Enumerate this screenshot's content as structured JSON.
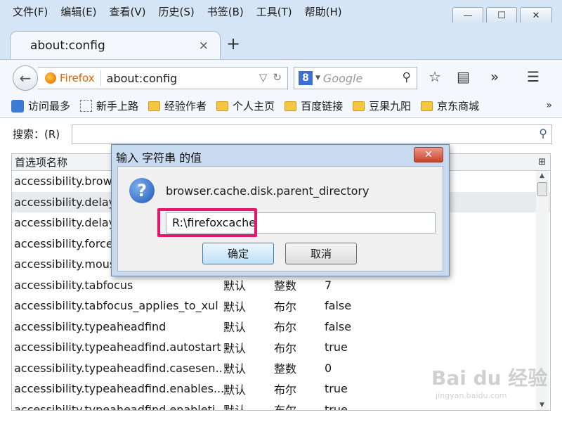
{
  "menubar": [
    "文件(F)",
    "编辑(E)",
    "查看(V)",
    "历史(S)",
    "书签(B)",
    "工具(T)",
    "帮助(H)"
  ],
  "window_buttons": {
    "minimize": "—",
    "maximize": "☐",
    "close": "✕"
  },
  "tab": {
    "title": "about:config",
    "close": "×",
    "new": "+"
  },
  "nav": {
    "back": "←",
    "identity": "Firefox",
    "url": "about:config",
    "search_placeholder": "Google",
    "search_engine_letter": "8"
  },
  "bookmarks": [
    "访问最多",
    "新手上路",
    "经验作者",
    "个人主页",
    "百度链接",
    "豆果九阳",
    "京东商城"
  ],
  "bookmarks_more": "»",
  "config": {
    "search_label": "搜索：(R)",
    "column_header": "首选项名称",
    "rows": [
      {
        "name": "accessibility.brow",
        "status": "",
        "type": "",
        "value": ""
      },
      {
        "name": "accessibility.delay",
        "status": "",
        "type": "",
        "value": ""
      },
      {
        "name": "accessibility.delay",
        "status": "",
        "type": "",
        "value": ""
      },
      {
        "name": "accessibility.force",
        "status": "",
        "type": "",
        "value": ""
      },
      {
        "name": "accessibility.mous",
        "status": "",
        "type": "",
        "value": ""
      },
      {
        "name": "accessibility.tabfocus",
        "status": "默认",
        "type": "整数",
        "value": "7"
      },
      {
        "name": "accessibility.tabfocus_applies_to_xul",
        "status": "默认",
        "type": "布尔",
        "value": "false"
      },
      {
        "name": "accessibility.typeaheadfind",
        "status": "默认",
        "type": "布尔",
        "value": "false"
      },
      {
        "name": "accessibility.typeaheadfind.autostart",
        "status": "默认",
        "type": "布尔",
        "value": "true"
      },
      {
        "name": "accessibility.typeaheadfind.casesen...",
        "status": "默认",
        "type": "整数",
        "value": "0"
      },
      {
        "name": "accessibility.typeaheadfind.enables...",
        "status": "默认",
        "type": "布尔",
        "value": "true"
      },
      {
        "name": "accessibility.typeaheadfind.enableti",
        "status": "默认",
        "type": "布尔",
        "value": "true"
      }
    ]
  },
  "dialog": {
    "title": "输入 字符串 的值",
    "close": "✕",
    "prompt": "browser.cache.disk.parent_directory",
    "value": "R:\\firefoxcache",
    "ok": "确定",
    "cancel": "取消"
  },
  "watermark": {
    "line1": "Bai du 经验",
    "line2": "jingyan.baidu.com"
  }
}
